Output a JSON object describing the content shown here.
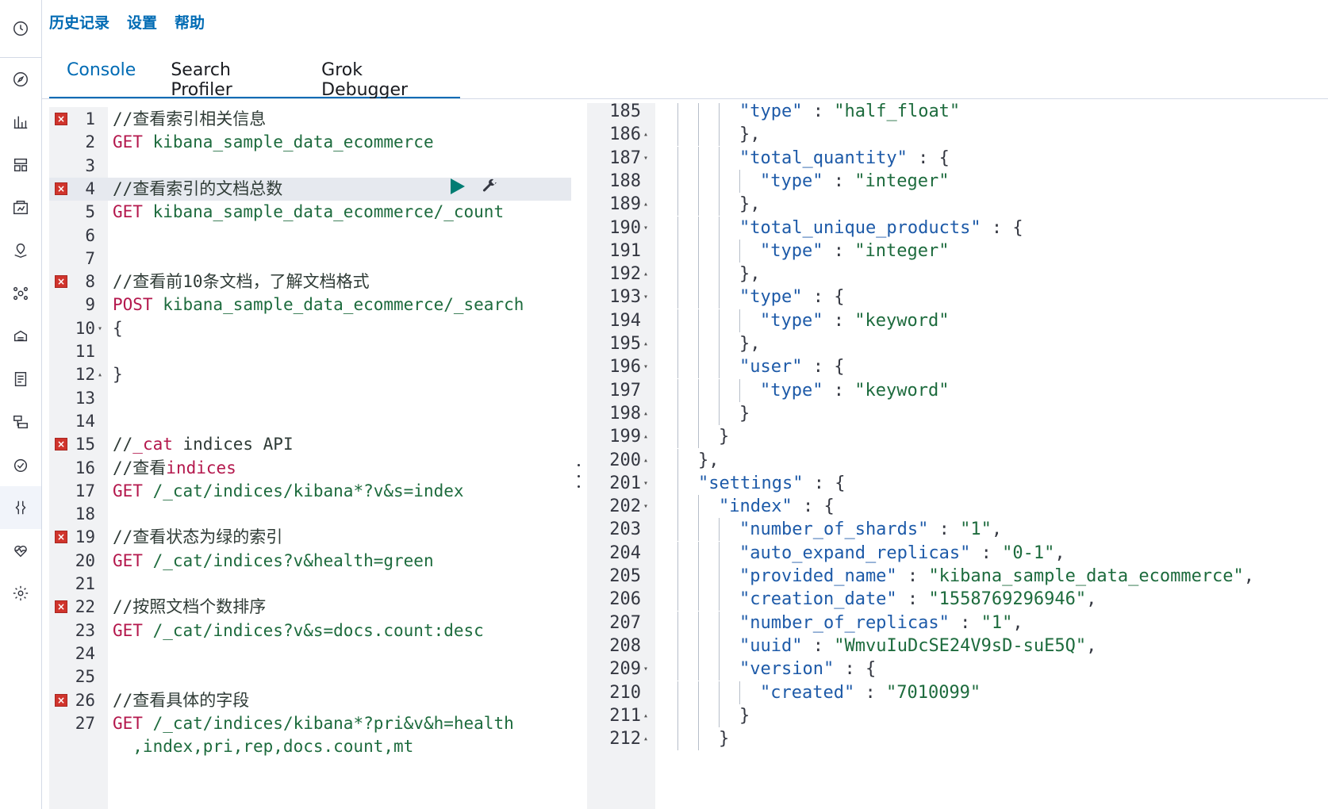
{
  "top_menu": [
    "历史记录",
    "设置",
    "帮助"
  ],
  "tabs": [
    {
      "label": "Console",
      "selected": true
    },
    {
      "label": "Search Profiler",
      "selected": false
    },
    {
      "label": "Grok Debugger",
      "selected": false
    }
  ],
  "sidebar_icons": [
    "clock-icon",
    "compass-icon",
    "visualize-icon",
    "dashboard-icon",
    "canvas-icon",
    "maps-icon",
    "ml-icon",
    "infrastructure-icon",
    "logs-icon",
    "apm-icon",
    "uptime-icon",
    "dev-tools-icon",
    "monitoring-icon",
    "management-gear-icon"
  ],
  "editor": {
    "lines": [
      {
        "n": "1",
        "err": true,
        "fold": "",
        "parts": [
          [
            "c-comment",
            "//查看索引相关信息"
          ]
        ]
      },
      {
        "n": "2",
        "err": false,
        "fold": "",
        "parts": [
          [
            "c-method",
            "GET"
          ],
          [
            "c-url",
            " kibana_sample_data_ecommerce"
          ]
        ]
      },
      {
        "n": "3",
        "err": false,
        "fold": "",
        "parts": []
      },
      {
        "n": "4",
        "err": true,
        "fold": "",
        "hl": true,
        "parts": [
          [
            "c-comment",
            "//查看索引的文档总数"
          ]
        ]
      },
      {
        "n": "5",
        "err": false,
        "fold": "",
        "parts": [
          [
            "c-method",
            "GET"
          ],
          [
            "c-url",
            " kibana_sample_data_ecommerce/_count"
          ]
        ]
      },
      {
        "n": "6",
        "err": false,
        "fold": "",
        "parts": []
      },
      {
        "n": "7",
        "err": false,
        "fold": "",
        "parts": []
      },
      {
        "n": "8",
        "err": true,
        "fold": "",
        "parts": [
          [
            "c-comment",
            "//查看前10条文档，了解文档格式"
          ]
        ]
      },
      {
        "n": "9",
        "err": false,
        "fold": "",
        "parts": [
          [
            "c-method",
            "POST"
          ],
          [
            "c-url",
            " kibana_sample_data_ecommerce/_search"
          ]
        ]
      },
      {
        "n": "10",
        "err": false,
        "fold": "▾",
        "parts": [
          [
            "c-brace",
            "{"
          ]
        ]
      },
      {
        "n": "11",
        "err": false,
        "fold": "",
        "parts": []
      },
      {
        "n": "12",
        "err": false,
        "fold": "▴",
        "parts": [
          [
            "c-brace",
            "}"
          ]
        ]
      },
      {
        "n": "13",
        "err": false,
        "fold": "",
        "parts": []
      },
      {
        "n": "14",
        "err": false,
        "fold": "",
        "parts": []
      },
      {
        "n": "15",
        "err": true,
        "fold": "",
        "parts": [
          [
            "c-comment",
            "//"
          ],
          [
            "c-method",
            "_cat"
          ],
          [
            "c-comment",
            " indices API"
          ]
        ]
      },
      {
        "n": "16",
        "err": false,
        "fold": "",
        "parts": [
          [
            "c-comment",
            "//查看"
          ],
          [
            "c-method",
            "indices"
          ]
        ]
      },
      {
        "n": "17",
        "err": false,
        "fold": "",
        "parts": [
          [
            "c-method",
            "GET"
          ],
          [
            "c-url",
            " /_cat/indices/kibana*?v&s=index"
          ]
        ]
      },
      {
        "n": "18",
        "err": false,
        "fold": "",
        "parts": []
      },
      {
        "n": "19",
        "err": true,
        "fold": "",
        "parts": [
          [
            "c-comment",
            "//查看状态为绿的索引"
          ]
        ]
      },
      {
        "n": "20",
        "err": false,
        "fold": "",
        "parts": [
          [
            "c-method",
            "GET"
          ],
          [
            "c-url",
            " /_cat/indices?v&health=green"
          ]
        ]
      },
      {
        "n": "21",
        "err": false,
        "fold": "",
        "parts": []
      },
      {
        "n": "22",
        "err": true,
        "fold": "",
        "parts": [
          [
            "c-comment",
            "//按照文档个数排序"
          ]
        ]
      },
      {
        "n": "23",
        "err": false,
        "fold": "",
        "parts": [
          [
            "c-method",
            "GET"
          ],
          [
            "c-url",
            " /_cat/indices?v&s=docs.count:desc"
          ]
        ]
      },
      {
        "n": "24",
        "err": false,
        "fold": "",
        "parts": []
      },
      {
        "n": "25",
        "err": false,
        "fold": "",
        "parts": []
      },
      {
        "n": "26",
        "err": true,
        "fold": "",
        "parts": [
          [
            "c-comment",
            "//查看具体的字段"
          ]
        ]
      },
      {
        "n": "27",
        "err": false,
        "fold": "",
        "parts": [
          [
            "c-method",
            "GET"
          ],
          [
            "c-url",
            " /_cat/indices/kibana*?pri&v&h=health"
          ]
        ]
      },
      {
        "n": "",
        "err": false,
        "fold": "",
        "parts": [
          [
            "c-url",
            "  ,index,pri,rep,docs.count,mt"
          ]
        ]
      }
    ],
    "error_marker": "×"
  },
  "output": {
    "lines": [
      {
        "n": "185",
        "fold": "",
        "indent": 3,
        "parts": [
          [
            "key",
            "\"type\""
          ],
          [
            "pun",
            " : "
          ],
          [
            "str",
            "\"half_float\""
          ]
        ]
      },
      {
        "n": "186",
        "fold": "▴",
        "indent": 3,
        "parts": [
          [
            "pun",
            "},"
          ]
        ]
      },
      {
        "n": "187",
        "fold": "▾",
        "indent": 3,
        "parts": [
          [
            "key",
            "\"total_quantity\""
          ],
          [
            "pun",
            " : {"
          ]
        ]
      },
      {
        "n": "188",
        "fold": "",
        "indent": 4,
        "parts": [
          [
            "key",
            "\"type\""
          ],
          [
            "pun",
            " : "
          ],
          [
            "str",
            "\"integer\""
          ]
        ]
      },
      {
        "n": "189",
        "fold": "▴",
        "indent": 3,
        "parts": [
          [
            "pun",
            "},"
          ]
        ]
      },
      {
        "n": "190",
        "fold": "▾",
        "indent": 3,
        "parts": [
          [
            "key",
            "\"total_unique_products\""
          ],
          [
            "pun",
            " : {"
          ]
        ]
      },
      {
        "n": "191",
        "fold": "",
        "indent": 4,
        "parts": [
          [
            "key",
            "\"type\""
          ],
          [
            "pun",
            " : "
          ],
          [
            "str",
            "\"integer\""
          ]
        ]
      },
      {
        "n": "192",
        "fold": "▴",
        "indent": 3,
        "parts": [
          [
            "pun",
            "},"
          ]
        ]
      },
      {
        "n": "193",
        "fold": "▾",
        "indent": 3,
        "parts": [
          [
            "key",
            "\"type\""
          ],
          [
            "pun",
            " : {"
          ]
        ]
      },
      {
        "n": "194",
        "fold": "",
        "indent": 4,
        "parts": [
          [
            "key",
            "\"type\""
          ],
          [
            "pun",
            " : "
          ],
          [
            "str",
            "\"keyword\""
          ]
        ]
      },
      {
        "n": "195",
        "fold": "▴",
        "indent": 3,
        "parts": [
          [
            "pun",
            "},"
          ]
        ]
      },
      {
        "n": "196",
        "fold": "▾",
        "indent": 3,
        "parts": [
          [
            "key",
            "\"user\""
          ],
          [
            "pun",
            " : {"
          ]
        ]
      },
      {
        "n": "197",
        "fold": "",
        "indent": 4,
        "parts": [
          [
            "key",
            "\"type\""
          ],
          [
            "pun",
            " : "
          ],
          [
            "str",
            "\"keyword\""
          ]
        ]
      },
      {
        "n": "198",
        "fold": "▴",
        "indent": 3,
        "parts": [
          [
            "pun",
            "}"
          ]
        ]
      },
      {
        "n": "199",
        "fold": "▴",
        "indent": 2,
        "parts": [
          [
            "pun",
            "}"
          ]
        ]
      },
      {
        "n": "200",
        "fold": "▴",
        "indent": 1,
        "parts": [
          [
            "pun",
            "},"
          ]
        ]
      },
      {
        "n": "201",
        "fold": "▾",
        "indent": 1,
        "parts": [
          [
            "key",
            "\"settings\""
          ],
          [
            "pun",
            " : {"
          ]
        ]
      },
      {
        "n": "202",
        "fold": "▾",
        "indent": 2,
        "parts": [
          [
            "key",
            "\"index\""
          ],
          [
            "pun",
            " : {"
          ]
        ]
      },
      {
        "n": "203",
        "fold": "",
        "indent": 3,
        "parts": [
          [
            "key",
            "\"number_of_shards\""
          ],
          [
            "pun",
            " : "
          ],
          [
            "str",
            "\"1\""
          ],
          [
            "pun",
            ","
          ]
        ]
      },
      {
        "n": "204",
        "fold": "",
        "indent": 3,
        "parts": [
          [
            "key",
            "\"auto_expand_replicas\""
          ],
          [
            "pun",
            " : "
          ],
          [
            "str",
            "\"0-1\""
          ],
          [
            "pun",
            ","
          ]
        ]
      },
      {
        "n": "205",
        "fold": "",
        "indent": 3,
        "parts": [
          [
            "key",
            "\"provided_name\""
          ],
          [
            "pun",
            " : "
          ],
          [
            "str",
            "\"kibana_sample_data_ecommerce\""
          ],
          [
            "pun",
            ","
          ]
        ]
      },
      {
        "n": "206",
        "fold": "",
        "indent": 3,
        "parts": [
          [
            "key",
            "\"creation_date\""
          ],
          [
            "pun",
            " : "
          ],
          [
            "str",
            "\"1558769296946\""
          ],
          [
            "pun",
            ","
          ]
        ]
      },
      {
        "n": "207",
        "fold": "",
        "indent": 3,
        "parts": [
          [
            "key",
            "\"number_of_replicas\""
          ],
          [
            "pun",
            " : "
          ],
          [
            "str",
            "\"1\""
          ],
          [
            "pun",
            ","
          ]
        ]
      },
      {
        "n": "208",
        "fold": "",
        "indent": 3,
        "parts": [
          [
            "key",
            "\"uuid\""
          ],
          [
            "pun",
            " : "
          ],
          [
            "str",
            "\"WmvuIuDcSE24V9sD-suE5Q\""
          ],
          [
            "pun",
            ","
          ]
        ]
      },
      {
        "n": "209",
        "fold": "▾",
        "indent": 3,
        "parts": [
          [
            "key",
            "\"version\""
          ],
          [
            "pun",
            " : {"
          ]
        ]
      },
      {
        "n": "210",
        "fold": "",
        "indent": 4,
        "parts": [
          [
            "key",
            "\"created\""
          ],
          [
            "pun",
            " : "
          ],
          [
            "str",
            "\"7010099\""
          ]
        ]
      },
      {
        "n": "211",
        "fold": "▴",
        "indent": 3,
        "parts": [
          [
            "pun",
            "}"
          ]
        ]
      },
      {
        "n": "212",
        "fold": "▴",
        "indent": 2,
        "parts": [
          [
            "pun",
            "}"
          ]
        ]
      }
    ]
  }
}
